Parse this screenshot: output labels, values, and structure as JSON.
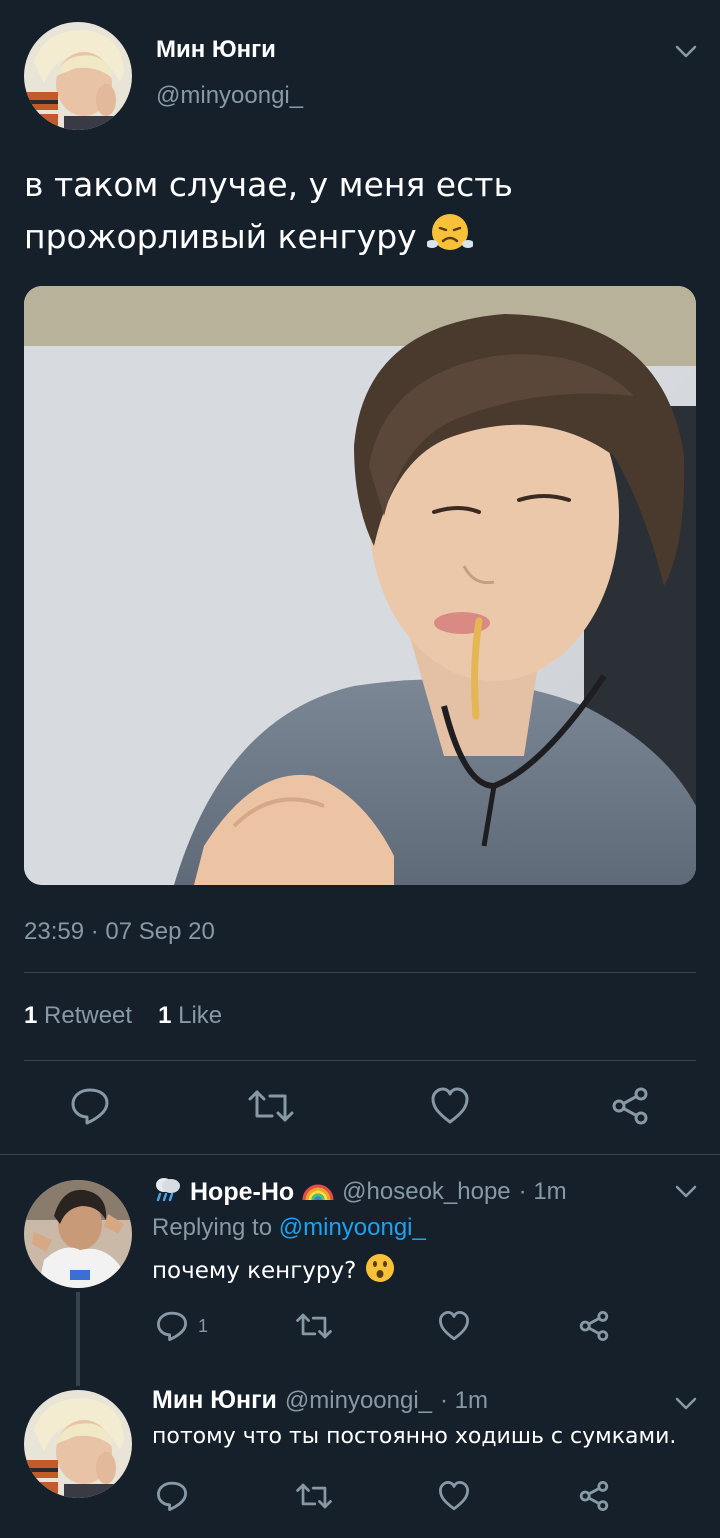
{
  "main_tweet": {
    "display_name": "Мин Юнги",
    "handle": "@minyoongi_",
    "text": "в таком случае, у меня есть прожорливый кенгуру",
    "text_line1": "в таком случае, у меня есть",
    "text_line2": "прожорливый кенгуру",
    "emoji": "face-with-steam-icon",
    "timestamp": "23:59 · 07 Sep 20",
    "retweet_count": "1",
    "retweet_label": "Retweet",
    "like_count": "1",
    "like_label": "Like"
  },
  "replies": [
    {
      "display_name": "Hope-Ho",
      "name_prefix_icon": "rain-cloud-icon",
      "name_suffix_icon": "rainbow-icon",
      "handle": "@hoseok_hope",
      "time": "· 1m",
      "replying_label": "Replying to",
      "replying_to": "@minyoongi_",
      "text": "почему кенгуру?",
      "emoji": "surprised-face-icon",
      "reply_count": "1"
    },
    {
      "display_name": "Мин Юнги",
      "handle": "@minyoongi_",
      "time": "· 1m",
      "text": "потому что ты постоянно ходишь с сумками."
    }
  ],
  "colors": {
    "background": "#15202b",
    "divider": "#38444d",
    "secondary_text": "#8899a6",
    "link": "#1da1f2"
  }
}
